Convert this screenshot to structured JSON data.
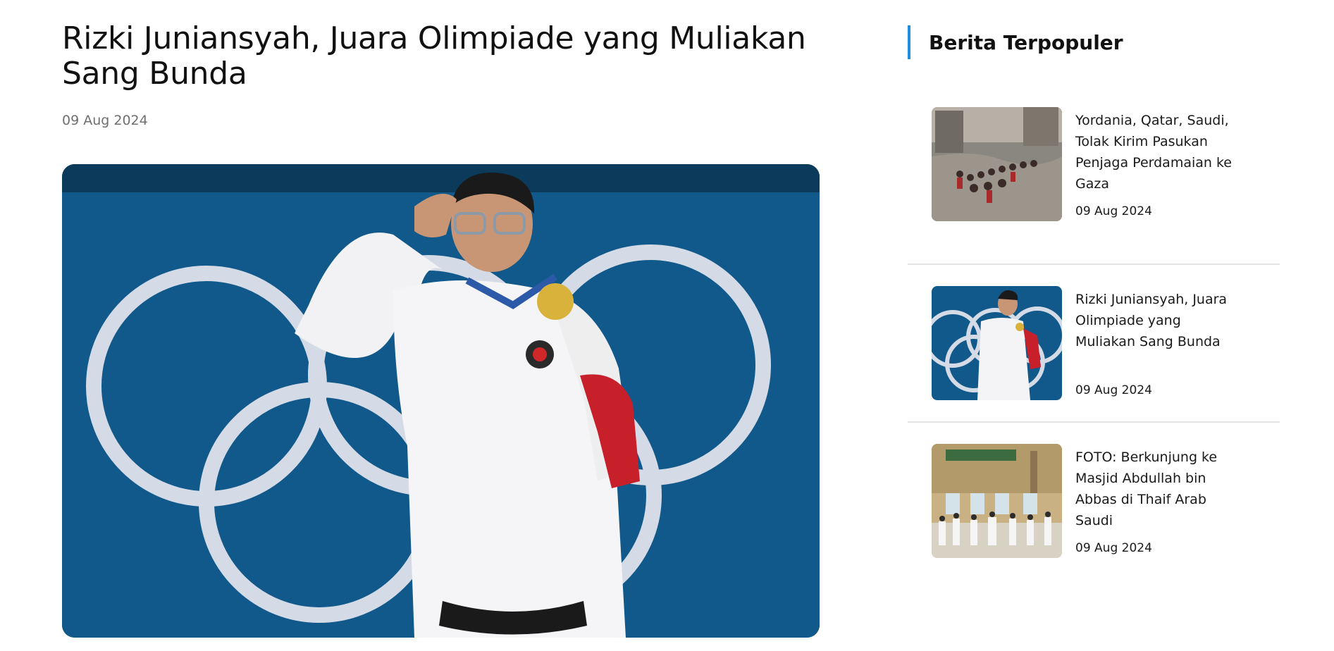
{
  "article": {
    "title": "Rizki Juniansyah, Juara Olimpiade yang Muliakan Sang Bunda",
    "date": "09 Aug 2024",
    "hero_image": "olympic-weightlifter-salute-photo"
  },
  "sidebar": {
    "title": "Berita Terpopuler",
    "accent_color": "#1f8ee0",
    "items": [
      {
        "title": "Yordania, Qatar, Saudi, Tolak Kirim Pasukan Penjaga Perdamaian ke Gaza",
        "date": "09 Aug 2024",
        "thumb": "gaza-rubble-crowd-photo"
      },
      {
        "title": "Rizki Juniansyah, Juara Olimpiade yang Muliakan Sang Bunda",
        "date": "09 Aug 2024",
        "thumb": "olympic-weightlifter-salute-photo"
      },
      {
        "title": "FOTO: Berkunjung ke Masjid Abdullah bin Abbas di Thaif Arab Saudi",
        "date": "09 Aug 2024",
        "thumb": "mosque-pilgrims-photo"
      }
    ]
  }
}
